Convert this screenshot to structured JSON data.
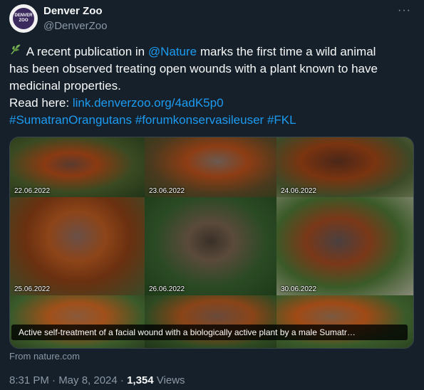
{
  "header": {
    "avatar_text_1": "DENVER",
    "avatar_text_2": "ZOO",
    "display_name": "Denver Zoo",
    "handle": "@DenverZoo",
    "more_label": "···"
  },
  "tweet": {
    "part1": " A recent publication in ",
    "mention": "@Nature",
    "part2": " marks the first time a wild animal",
    "line2": "has been observed treating open wounds with a plant known to have",
    "line3": "medicinal properties.",
    "read_here": "Read here: ",
    "link": "link.denverzoo.org/4adK5p0",
    "hashtag1": "#SumatranOrangutans",
    "hashtag2": "#forumkonservasileuser",
    "hashtag3": "#FKL"
  },
  "media": {
    "dates": [
      "22.06.2022",
      "23.06.2022",
      "24.06.2022",
      "25.06.2022",
      "26.06.2022",
      "30.06.2022"
    ],
    "caption": "Active self-treatment of a facial wound with a biologically active plant by a male Sumatr…"
  },
  "card": {
    "source": "From nature.com"
  },
  "meta": {
    "time": "8:31 PM · May 8, 2024 · ",
    "views_count": "1,354",
    "views_label": " Views"
  },
  "colors": {
    "background": "#15202b",
    "text": "#f7f9f9",
    "secondary": "#8b98a5",
    "link": "#1d9bf0",
    "border": "#38444d"
  },
  "icons": [
    "plant-emoji-icon",
    "more-options-icon"
  ]
}
